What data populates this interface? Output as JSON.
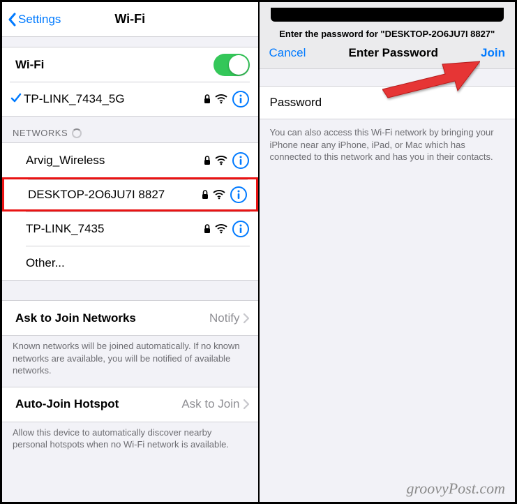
{
  "left": {
    "back_label": "Settings",
    "title": "Wi-Fi",
    "wifi_toggle_label": "Wi-Fi",
    "connected_network": "TP-LINK_7434_5G",
    "networks_header": "NETWORKS",
    "networks": [
      {
        "name": "Arvig_Wireless",
        "highlighted": false
      },
      {
        "name": "DESKTOP-2O6JU7I 8827",
        "highlighted": true
      },
      {
        "name": "TP-LINK_7435",
        "highlighted": false
      }
    ],
    "other_label": "Other...",
    "ask_label": "Ask to Join Networks",
    "ask_value": "Notify",
    "ask_footnote": "Known networks will be joined automatically. If no known networks are available, you will be notified of available networks.",
    "hotspot_label": "Auto-Join Hotspot",
    "hotspot_value": "Ask to Join",
    "hotspot_footnote": "Allow this device to automatically discover nearby personal hotspots when no Wi-Fi network is available."
  },
  "right": {
    "subtitle": "Enter the password for \"DESKTOP-2O6JU7I 8827\"",
    "cancel": "Cancel",
    "title": "Enter Password",
    "join": "Join",
    "password_label": "Password",
    "hint": "You can also access this Wi-Fi network by bringing your iPhone near any iPhone, iPad, or Mac which has connected to this network and has you in their contacts."
  },
  "watermark": "groovyPost.com"
}
